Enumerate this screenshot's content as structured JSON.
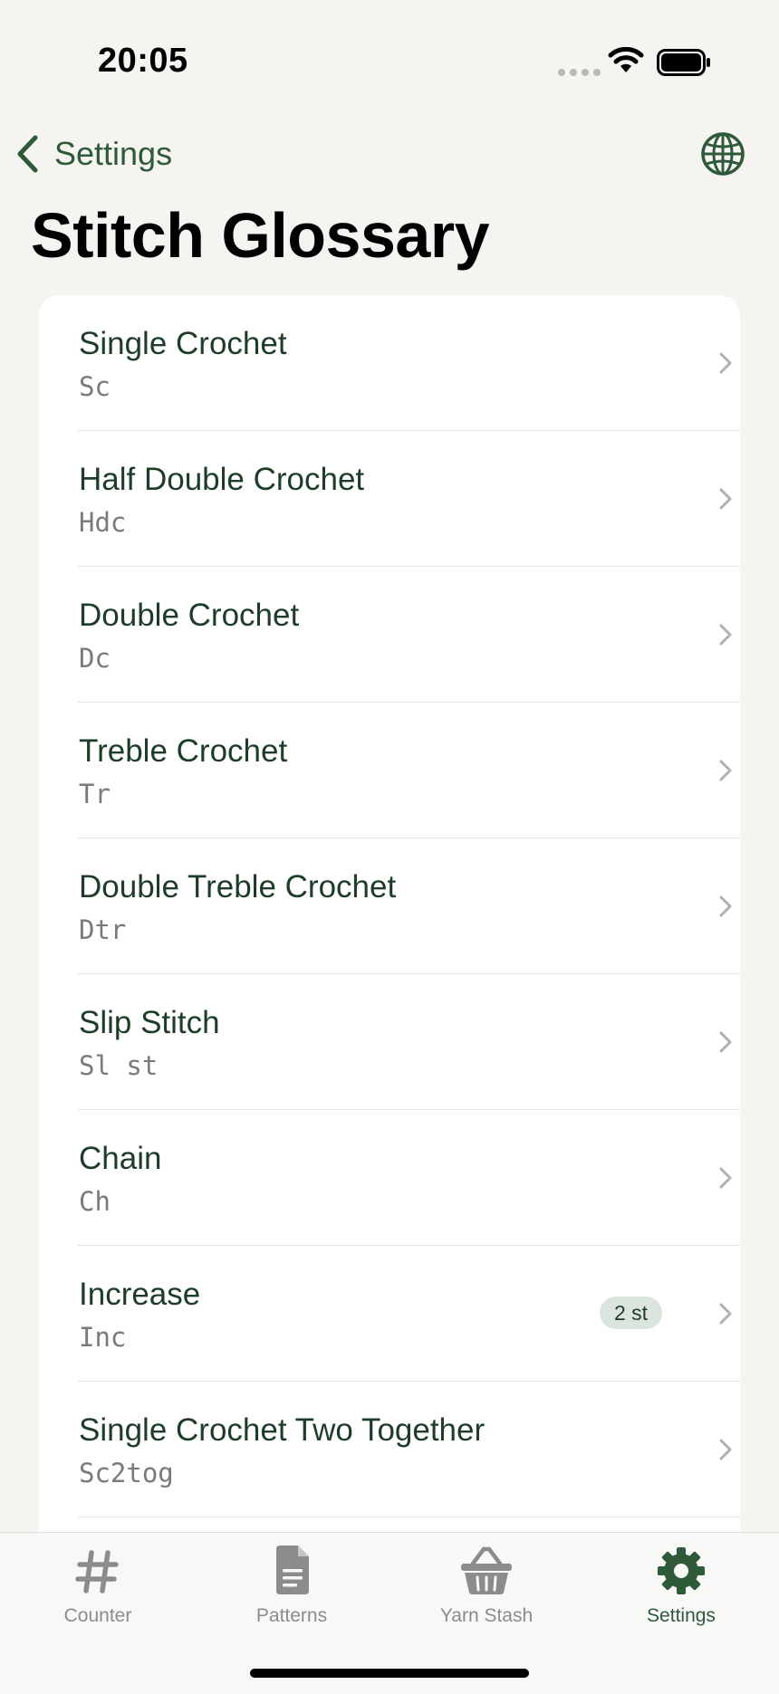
{
  "status": {
    "time": "20:05"
  },
  "nav": {
    "back_label": "Settings"
  },
  "page": {
    "title": "Stitch Glossary"
  },
  "stitches": [
    {
      "name": "Single Crochet",
      "abbr": "Sc"
    },
    {
      "name": "Half Double Crochet",
      "abbr": "Hdc"
    },
    {
      "name": "Double Crochet",
      "abbr": "Dc"
    },
    {
      "name": "Treble Crochet",
      "abbr": "Tr"
    },
    {
      "name": "Double Treble Crochet",
      "abbr": "Dtr"
    },
    {
      "name": "Slip Stitch",
      "abbr": "Sl st"
    },
    {
      "name": "Chain",
      "abbr": "Ch"
    },
    {
      "name": "Increase",
      "abbr": "Inc",
      "badge": "2 st"
    },
    {
      "name": "Single Crochet Two Together",
      "abbr": "Sc2tog"
    }
  ],
  "tabs": [
    {
      "label": "Counter",
      "icon": "hash-icon"
    },
    {
      "label": "Patterns",
      "icon": "document-icon"
    },
    {
      "label": "Yarn Stash",
      "icon": "basket-icon"
    },
    {
      "label": "Settings",
      "icon": "gear-icon",
      "active": true
    }
  ],
  "colors": {
    "accent": "#2e5a3a",
    "text_dark_green": "#1e3d28",
    "background": "#f5f4f1",
    "badge_bg": "#dbe5dd"
  }
}
